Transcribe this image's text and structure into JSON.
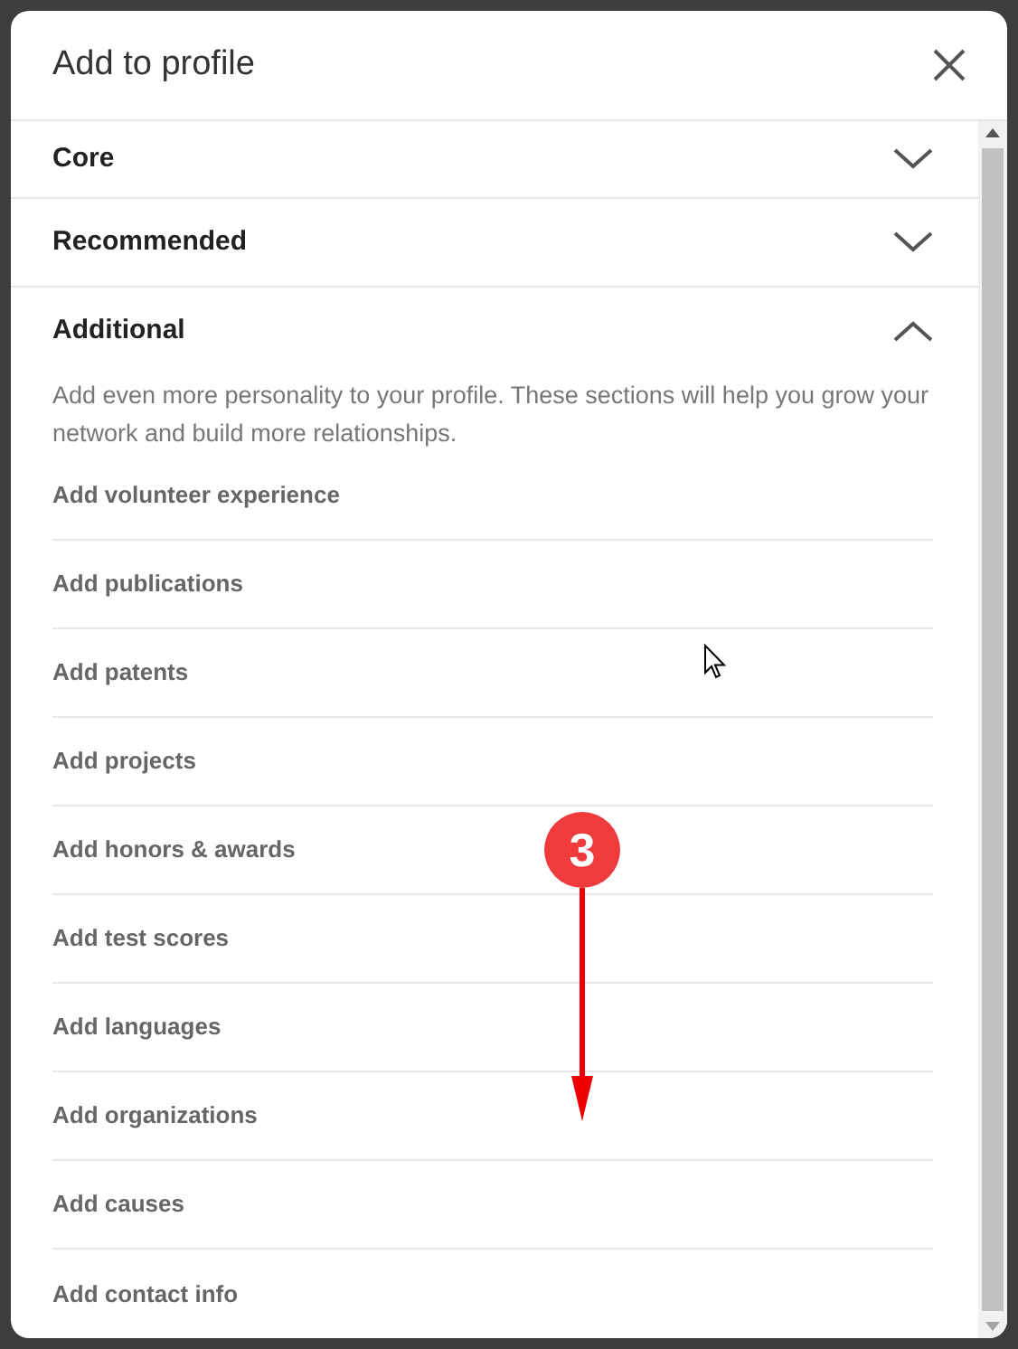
{
  "dialog": {
    "title": "Add to profile"
  },
  "sections": [
    {
      "label": "Core",
      "expanded": false
    },
    {
      "label": "Recommended",
      "expanded": false
    },
    {
      "label": "Additional",
      "expanded": true,
      "description": "Add even more personality to your profile. These sections will help you grow your network and build more relationships.",
      "items": [
        "Add volunteer experience",
        "Add publications",
        "Add patents",
        "Add projects",
        "Add honors & awards",
        "Add test scores",
        "Add languages",
        "Add organizations",
        "Add causes",
        "Add contact info"
      ]
    }
  ],
  "annotation": {
    "label": "3"
  }
}
